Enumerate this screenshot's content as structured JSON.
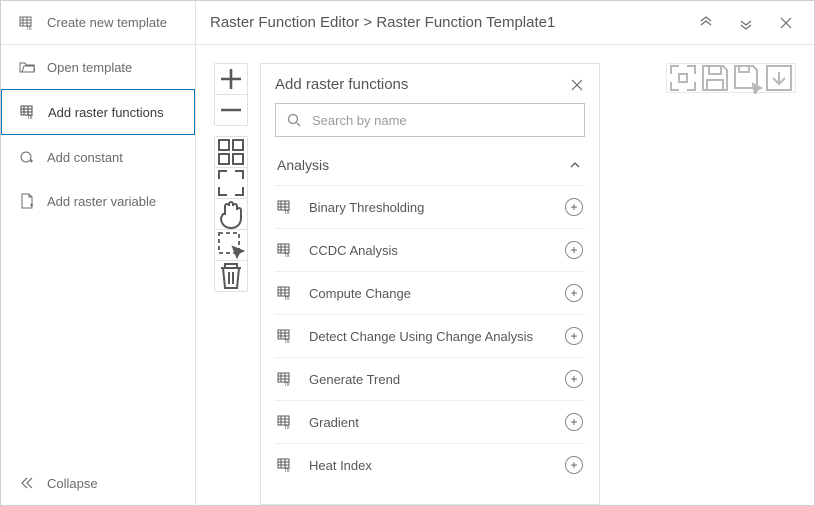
{
  "header": {
    "create_label": "Create new template",
    "breadcrumb": "Raster Function Editor > Raster Function Template1"
  },
  "sidebar": {
    "items": [
      {
        "label": "Open template"
      },
      {
        "label": "Add raster functions"
      },
      {
        "label": "Add constant"
      },
      {
        "label": "Add raster variable"
      }
    ],
    "collapse_label": "Collapse"
  },
  "panel": {
    "title": "Add raster functions",
    "search_placeholder": "Search by name",
    "category": "Analysis",
    "functions": [
      "Binary Thresholding",
      "CCDC Analysis",
      "Compute Change",
      "Detect Change Using Change Analysis",
      "Generate Trend",
      "Gradient",
      "Heat Index"
    ]
  }
}
